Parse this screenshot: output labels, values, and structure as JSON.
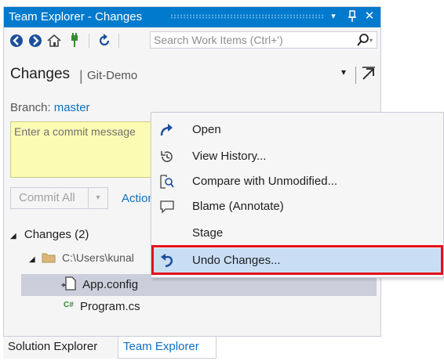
{
  "window": {
    "title": "Team Explorer - Changes",
    "controls": {
      "dropdown": "▾",
      "pin": "ᵖ",
      "close": "✕"
    }
  },
  "toolbar": {
    "buttons": [
      "back-icon",
      "forward-icon",
      "home-icon",
      "connect-icon",
      "refresh-icon"
    ],
    "search_placeholder": "Search Work Items (Ctrl+')",
    "search_icon_suffix": "▾"
  },
  "header": {
    "page": "Changes",
    "separator": "|",
    "repo": "Git-Demo",
    "dropdown": "▾"
  },
  "branch": {
    "label": "Branch:",
    "name": "master"
  },
  "commit": {
    "placeholder": "Enter a commit message",
    "button_label": "Commit All",
    "dropdown": "▾",
    "actions_label": "Actions"
  },
  "tree": {
    "group_label": "Changes (2)",
    "folder_label": "C:\\Users\\kunal",
    "files": [
      {
        "name": "App.config",
        "icon": "config-file-icon",
        "selected": true
      },
      {
        "name": "Program.cs",
        "icon": "csharp-file-icon",
        "csharp_badge": "C#",
        "selected": false
      }
    ]
  },
  "tabs": [
    {
      "label": "Solution Explorer",
      "active": false
    },
    {
      "label": "Team Explorer",
      "active": true
    }
  ],
  "context_menu": {
    "items": [
      {
        "label": "Open",
        "icon": "open-arrow-icon"
      },
      {
        "label": "View History...",
        "icon": "history-icon"
      },
      {
        "label": "Compare with Unmodified...",
        "icon": "compare-icon"
      },
      {
        "label": "Blame (Annotate)",
        "icon": "blame-comment-icon"
      },
      {
        "label": "Stage",
        "icon": ""
      },
      {
        "label": "Undo Changes...",
        "icon": "undo-icon",
        "highlighted": true
      }
    ]
  },
  "colors": {
    "accent": "#007acc",
    "link": "#0e70c0",
    "commit_box": "#fbfbb3",
    "selection": "#cccedb",
    "menu_highlight": "#c9def5",
    "callout": "#e3101a"
  }
}
